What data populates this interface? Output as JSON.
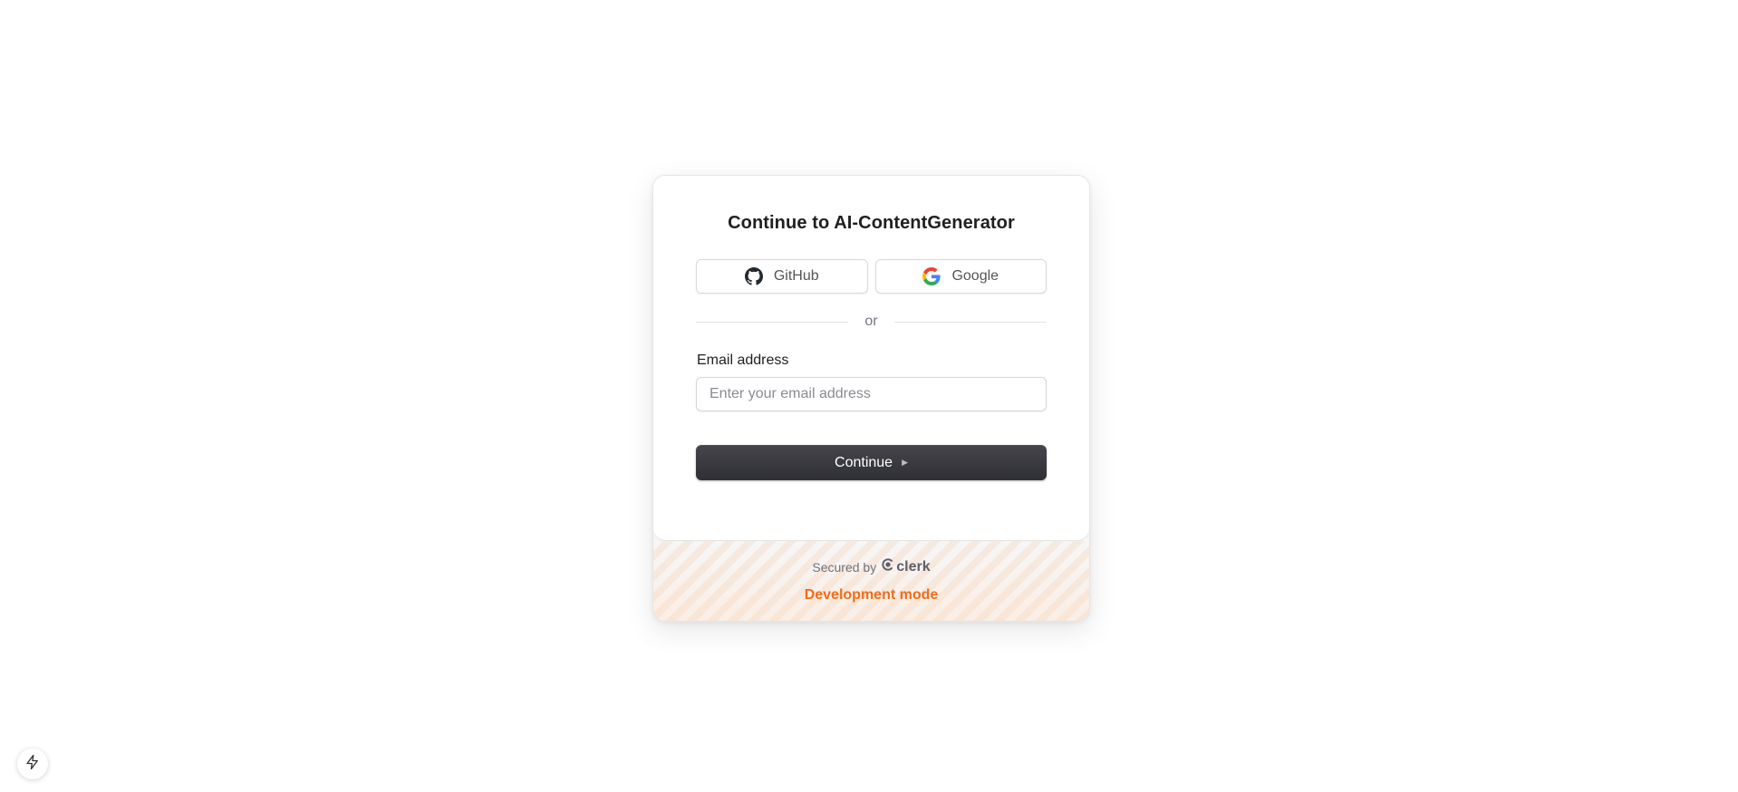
{
  "signin": {
    "title": "Continue to AI-ContentGenerator",
    "social": {
      "github_label": "GitHub",
      "google_label": "Google"
    },
    "divider_text": "or",
    "email": {
      "label": "Email address",
      "placeholder": "Enter your email address",
      "value": ""
    },
    "continue_label": "Continue"
  },
  "footer": {
    "secured_by": "Secured by",
    "brand": "clerk",
    "dev_mode": "Development mode"
  },
  "icons": {
    "github": "github-icon",
    "google": "google-icon",
    "continue_caret": "caret-right-icon",
    "clerk": "clerk-logo-icon",
    "corner": "lightning-bolt-icon"
  },
  "colors": {
    "accent_dev": "#f36b16",
    "primary_button": "#3a3a40"
  }
}
